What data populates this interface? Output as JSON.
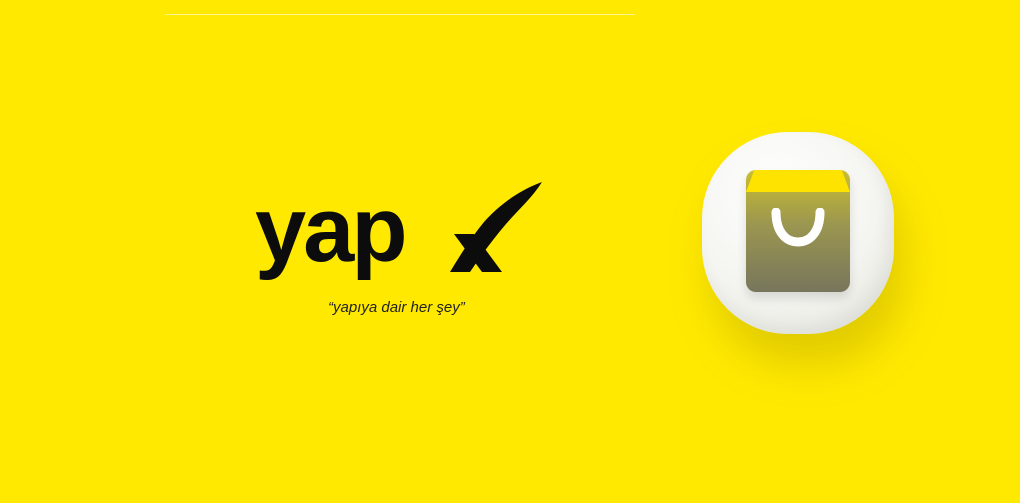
{
  "brand": {
    "wordmark": "yap",
    "tagline": "“yapıya dair her şey”"
  },
  "icons": {
    "logo_mark": "x-checkmark-icon",
    "app_icon": "shopping-bag-icon"
  },
  "colors": {
    "background": "#FFE900",
    "wordmark": "#0c0c0c",
    "bag_top": "#FFE300",
    "icon_tile": "#f4f4f0"
  }
}
